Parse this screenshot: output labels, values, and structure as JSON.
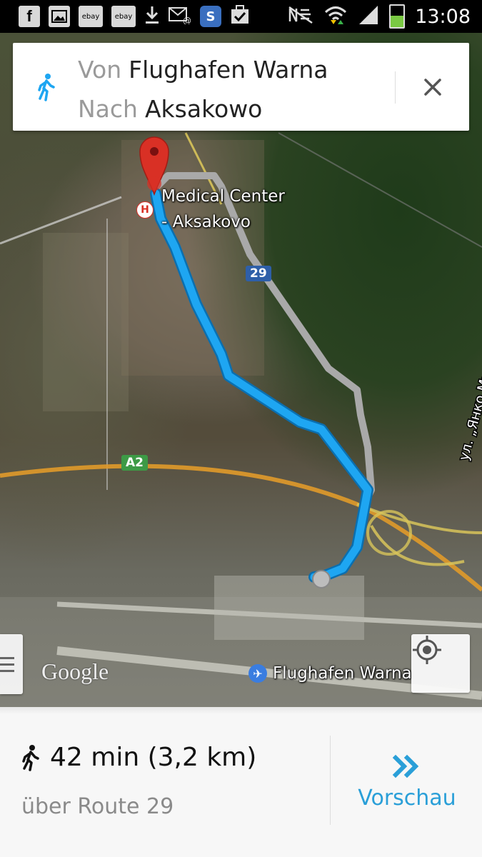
{
  "status_bar": {
    "time": "13:08",
    "left_icons": [
      "facebook-icon",
      "gallery-icon",
      "ebay-icon",
      "ebay-icon",
      "download-icon",
      "email-icon",
      "skype-icon",
      "task-icon"
    ],
    "right_icons": [
      "mute-icon",
      "wifi-icon",
      "signal-icon",
      "battery-charging-icon"
    ],
    "ebay_label": "ebay",
    "fb_label": "f",
    "skype_label": "S"
  },
  "route_card": {
    "mode_icon": "walk-icon",
    "from_label": "Von",
    "from_value": "Flughafen Warna",
    "to_label": "Nach",
    "to_value": "Aksakowo",
    "close_icon": "close-icon"
  },
  "map": {
    "destination_label_line1": "Medical Center",
    "destination_label_line2": "- Aksakovo",
    "hospital_marker": "H",
    "road_29": "29",
    "road_a2": "A2",
    "street_label": "ул. „Янко Мустаков\"",
    "airport_label": "Flughafen Warna",
    "google_logo": "Google",
    "route_color": "#1ea6f2",
    "alt_route_color": "#a9a9a9",
    "marker_color": "#d93025"
  },
  "bottom_panel": {
    "mode_icon": "walk-icon",
    "duration_distance": "42 min (3,2 km)",
    "via": "über Route 29",
    "preview_label": "Vorschau",
    "preview_icon": "double-chevron-right-icon",
    "accent": "#2a9fd8"
  }
}
